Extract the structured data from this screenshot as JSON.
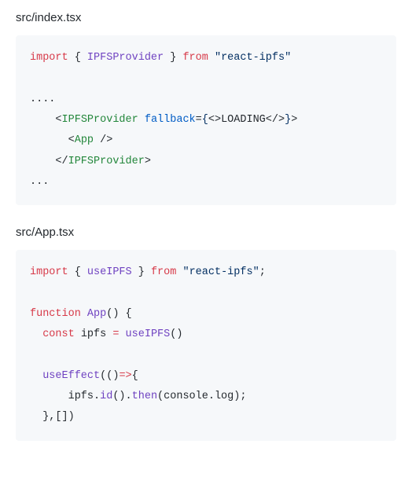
{
  "tokenColors": {
    "keyword": "#d73a49",
    "type": "#6f42c1",
    "attr": "#005cc5",
    "string": "#032f62",
    "tag": "#22863a",
    "plain": "#24292e"
  },
  "files": [
    {
      "path": "src/index.tsx",
      "lines": [
        [
          [
            "kw",
            "import"
          ],
          [
            "pl",
            " { "
          ],
          [
            "ty",
            "IPFSProvider"
          ],
          [
            "pl",
            " } "
          ],
          [
            "kw",
            "from"
          ],
          [
            "pl",
            " "
          ],
          [
            "str",
            "\"react-ipfs\""
          ]
        ],
        [
          [
            "pl",
            ""
          ]
        ],
        [
          [
            "pl",
            "...."
          ]
        ],
        [
          [
            "pl",
            "    <"
          ],
          [
            "tag",
            "IPFSProvider"
          ],
          [
            "pl",
            " "
          ],
          [
            "attr",
            "fallback"
          ],
          [
            "pl",
            "="
          ],
          [
            "str",
            "{"
          ],
          [
            "pl",
            "<>"
          ],
          [
            "pl",
            "LOADING"
          ],
          [
            "pl",
            "</>"
          ],
          [
            "str",
            "}"
          ],
          [
            "pl",
            ">"
          ]
        ],
        [
          [
            "pl",
            "      <"
          ],
          [
            "tag",
            "App"
          ],
          [
            "pl",
            " />"
          ]
        ],
        [
          [
            "pl",
            "    </"
          ],
          [
            "tag",
            "IPFSProvider"
          ],
          [
            "pl",
            ">"
          ]
        ],
        [
          [
            "pl",
            "..."
          ]
        ]
      ]
    },
    {
      "path": "src/App.tsx",
      "lines": [
        [
          [
            "kw",
            "import"
          ],
          [
            "pl",
            " { "
          ],
          [
            "ty",
            "useIPFS"
          ],
          [
            "pl",
            " } "
          ],
          [
            "kw",
            "from"
          ],
          [
            "pl",
            " "
          ],
          [
            "str",
            "\"react-ipfs\""
          ],
          [
            "pl",
            ";"
          ]
        ],
        [
          [
            "pl",
            ""
          ]
        ],
        [
          [
            "kw",
            "function"
          ],
          [
            "pl",
            " "
          ],
          [
            "ty",
            "App"
          ],
          [
            "pl",
            "() {"
          ]
        ],
        [
          [
            "pl",
            "  "
          ],
          [
            "kw",
            "const"
          ],
          [
            "pl",
            " ipfs "
          ],
          [
            "kw",
            "="
          ],
          [
            "pl",
            " "
          ],
          [
            "ty",
            "useIPFS"
          ],
          [
            "pl",
            "()"
          ]
        ],
        [
          [
            "pl",
            ""
          ]
        ],
        [
          [
            "pl",
            "  "
          ],
          [
            "ty",
            "useEffect"
          ],
          [
            "pl",
            "(()"
          ],
          [
            "kw",
            "=>"
          ],
          [
            "pl",
            "{"
          ]
        ],
        [
          [
            "pl",
            "      ipfs."
          ],
          [
            "ty",
            "id"
          ],
          [
            "pl",
            "()."
          ],
          [
            "ty",
            "then"
          ],
          [
            "pl",
            "(console.log);"
          ]
        ],
        [
          [
            "pl",
            "  },[])"
          ]
        ]
      ]
    }
  ]
}
